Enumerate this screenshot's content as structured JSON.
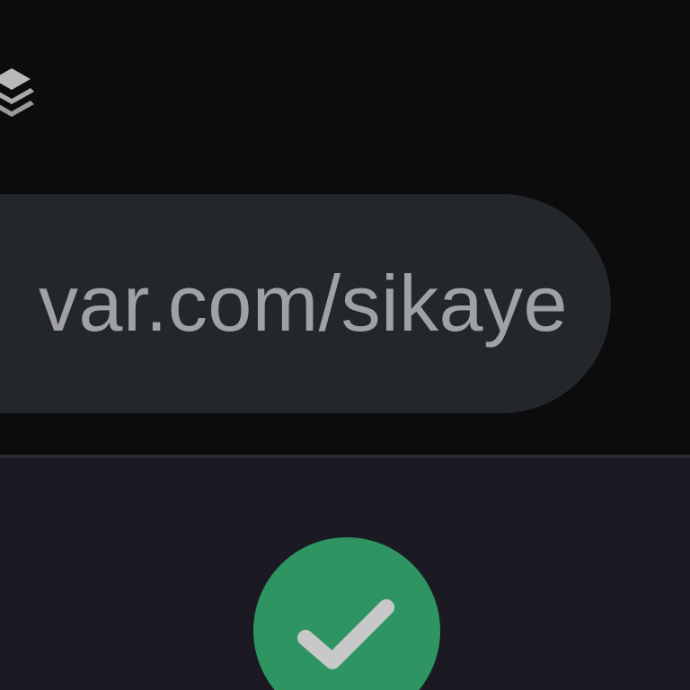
{
  "address_bar": {
    "url_visible": "var.com/sikaye"
  },
  "icons": {
    "layers": "layers-icon",
    "confirm": "check-icon"
  },
  "colors": {
    "background_top": "#0c0c0d",
    "background_bottom": "#1b1a22",
    "pill": "#23262b",
    "url_text": "#9fa1a4",
    "accent_green": "#2e9462",
    "check": "#c8c8c8"
  }
}
